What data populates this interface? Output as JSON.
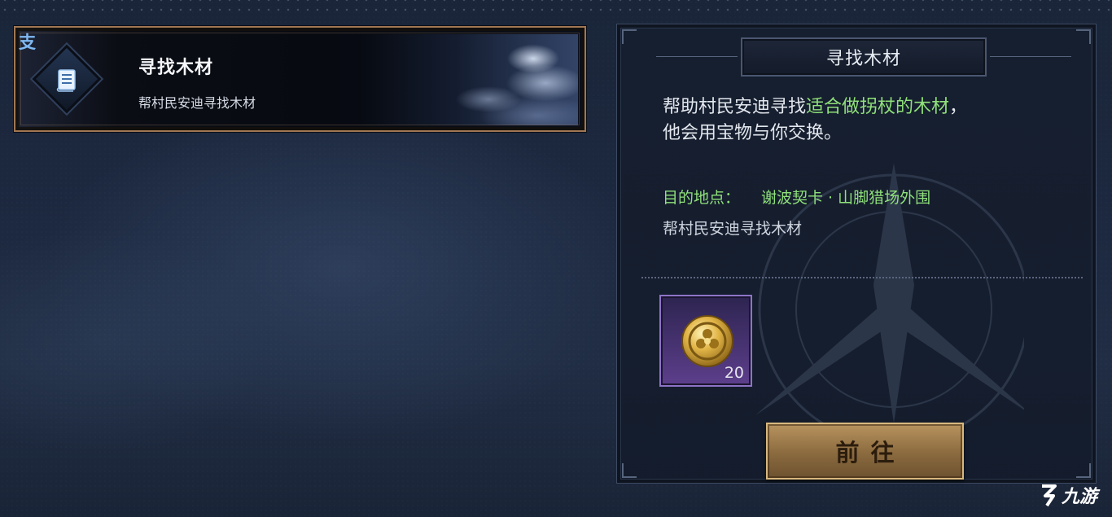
{
  "quest_card": {
    "branch_tag": "支",
    "title": "寻找木材",
    "subtitle": "帮村民安迪寻找木材"
  },
  "detail": {
    "title": "寻找木材",
    "desc_part1": "帮助村民安迪寻找",
    "desc_highlight": "适合做拐杖的木材",
    "desc_part2": "，",
    "desc_line2": "他会用宝物与你交换。",
    "destination_label": "目的地点：",
    "destination_value": "谢波契卡 · 山脚猎场外围",
    "note": "帮村民安迪寻找木材",
    "reward": {
      "icon": "gold-coin-icon",
      "quantity": "20"
    },
    "go_button_label": "前往"
  },
  "watermark": {
    "logo_text": "九游"
  },
  "colors": {
    "highlight_green": "#8fe07a",
    "card_border": "#a17752",
    "reward_frame": "#8e74c7",
    "button_gold": "#b8935f"
  }
}
